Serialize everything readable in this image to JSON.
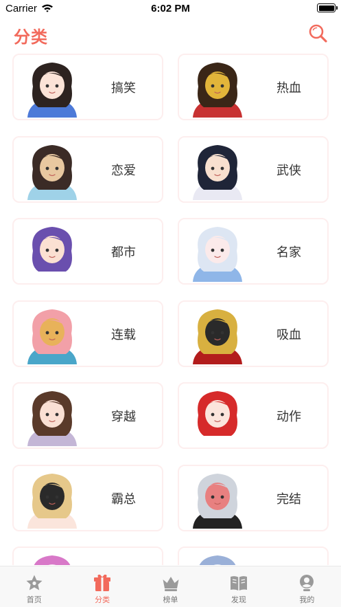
{
  "status_bar": {
    "carrier": "Carrier",
    "time": "6:02 PM",
    "battery_level": 1.0
  },
  "header": {
    "title": "分类",
    "search_icon": "search-icon"
  },
  "categories": [
    {
      "label": "搞笑",
      "thumb_colors": [
        "#2d2320",
        "#fbe3d7",
        "#4d7ad8"
      ]
    },
    {
      "label": "热血",
      "thumb_colors": [
        "#3a2617",
        "#e2b53a",
        "#c83131"
      ]
    },
    {
      "label": "恋爱",
      "thumb_colors": [
        "#3b2b26",
        "#e8c8a0",
        "#9fd2e8"
      ]
    },
    {
      "label": "武侠",
      "thumb_colors": [
        "#1f2538",
        "#f8e0cf",
        "#e9e9f3"
      ]
    },
    {
      "label": "都市",
      "thumb_colors": [
        "#6a4fae",
        "#fbe0d2",
        "#ffffff"
      ]
    },
    {
      "label": "名家",
      "thumb_colors": [
        "#dde6f3",
        "#fbeaea",
        "#8fb6e8"
      ]
    },
    {
      "label": "连载",
      "thumb_colors": [
        "#f2a0a8",
        "#e8b25a",
        "#4aa6c9"
      ]
    },
    {
      "label": "吸血",
      "thumb_colors": [
        "#d8b040",
        "#2a2a2a",
        "#b31c1c"
      ]
    },
    {
      "label": "穿越",
      "thumb_colors": [
        "#5a3a2a",
        "#fae0d4",
        "#c4b6d6"
      ]
    },
    {
      "label": "动作",
      "thumb_colors": [
        "#d62a2a",
        "#fbe5dc",
        "#ffffff"
      ]
    },
    {
      "label": "霸总",
      "thumb_colors": [
        "#e6c88a",
        "#2a2a2a",
        "#fbe5dc"
      ]
    },
    {
      "label": "完结",
      "thumb_colors": [
        "#cfd4dc",
        "#e88080",
        "#222222"
      ]
    },
    {
      "label": "",
      "thumb_colors": [
        "#d878c8",
        "#f3e0f0",
        "#ffffff"
      ]
    },
    {
      "label": "",
      "thumb_colors": [
        "#9ab0d8",
        "#e9eef7",
        "#ffffff"
      ]
    }
  ],
  "tab_bar": {
    "accent": "#f26a5c",
    "inactive": "#9a9a9a",
    "items": [
      {
        "label": "首页",
        "icon": "star-icon",
        "active": false
      },
      {
        "label": "分类",
        "icon": "gift-box-icon",
        "active": true
      },
      {
        "label": "榜单",
        "icon": "crown-icon",
        "active": false
      },
      {
        "label": "发现",
        "icon": "book-icon",
        "active": false
      },
      {
        "label": "我的",
        "icon": "person-icon",
        "active": false
      }
    ]
  }
}
